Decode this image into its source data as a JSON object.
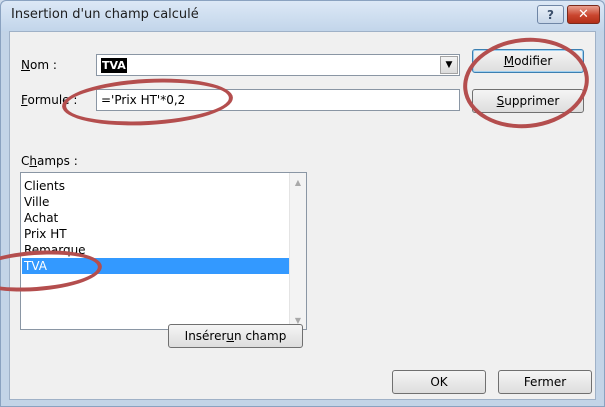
{
  "window": {
    "title": "Insertion d'un champ calculé",
    "help_label": "?",
    "close_label": "✕"
  },
  "form": {
    "name_label_key": "N",
    "name_label_rest": "om :",
    "name_value": "TVA",
    "combo_arrow": "▼",
    "formula_label_key": "F",
    "formula_label_rest": "ormule :",
    "formula_value": "='Prix HT'*0,2"
  },
  "buttons": {
    "modify_key": "M",
    "modify_rest": "odifier",
    "delete_key": "S",
    "delete_rest": "upprimer",
    "insert_pre": "Insérer ",
    "insert_key": "u",
    "insert_post": "n champ",
    "ok": "OK",
    "close": "Fermer"
  },
  "fields": {
    "label_pre": "C",
    "label_key": "h",
    "label_post": "amps :",
    "items": [
      "Clients",
      "Ville",
      "Achat",
      "Prix HT",
      "Remarque",
      "TVA"
    ],
    "selected": "TVA"
  },
  "colors": {
    "annotation": "#b44e4e",
    "selection": "#3399ff"
  }
}
